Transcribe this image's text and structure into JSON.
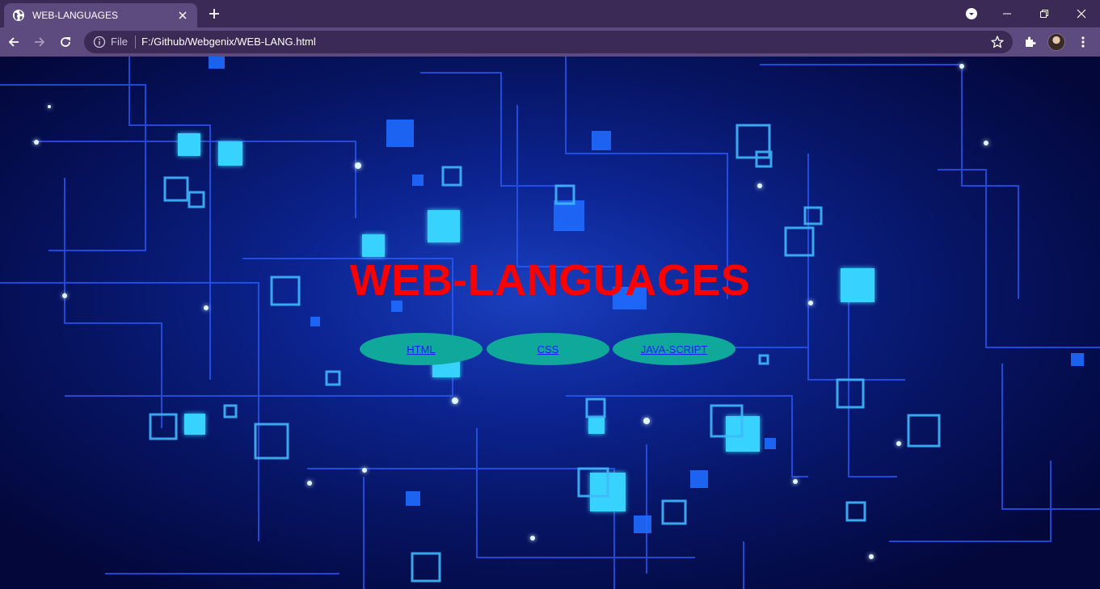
{
  "browser": {
    "tab_title": "WEB-LANGUAGES",
    "url_scheme": "File",
    "url": "F:/Github/Webgenix/WEB-LANG.html",
    "icons": [
      "globe-icon",
      "close-icon",
      "plus-icon",
      "back-icon",
      "forward-icon",
      "reload-icon",
      "info-icon",
      "star-icon",
      "extensions-icon",
      "menu-icon",
      "tab-search-icon",
      "minimize-icon",
      "restore-icon",
      "window-close-icon"
    ]
  },
  "page": {
    "heading": "WEB-LANGUAGES",
    "links": [
      {
        "label": "HTML"
      },
      {
        "label": "CSS"
      },
      {
        "label": "JAVA-SCRIPT"
      }
    ],
    "colors": {
      "heading": "#ff0000",
      "button": "#10a89a",
      "link": "#1a1aff",
      "background": "#0c2491"
    }
  }
}
